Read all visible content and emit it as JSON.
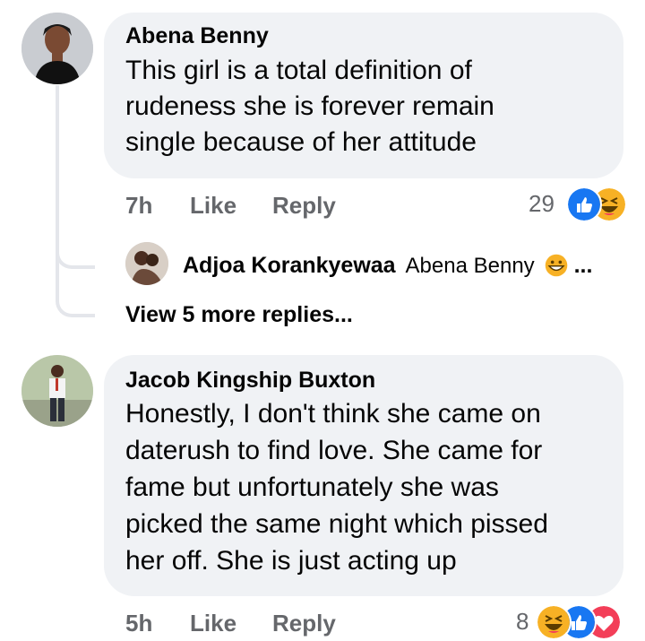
{
  "comments": [
    {
      "author": "Abena Benny",
      "lines": [
        "This girl is a total definition of",
        "rudeness she is forever remain",
        "single because of her attitude"
      ],
      "time": "7h",
      "like_label": "Like",
      "reply_label": "Reply",
      "reaction_count": "29",
      "reactions": [
        "like-icon",
        "haha-icon"
      ]
    },
    {
      "author": "Jacob Kingship Buxton",
      "lines": [
        "Honestly, I don't think she came on",
        "daterush to find love. She came for",
        "fame but unfortunately she was",
        "picked the same night which pissed",
        "her off. She is just acting up"
      ],
      "time": "5h",
      "like_label": "Like",
      "reply_label": "Reply",
      "reaction_count": "8",
      "reactions": [
        "haha-icon",
        "like-icon",
        "love-icon"
      ]
    }
  ],
  "reply_preview": {
    "author": "Adjoa Korankyewaa",
    "text": "Abena Benny",
    "ellipsis": "..."
  },
  "view_more": "View 5 more replies...",
  "colors": {
    "bubble": "#f0f2f5",
    "secondary_text": "#65676b",
    "like_blue": "#1877f2",
    "haha_yellow": "#f7b125",
    "love_red": "#f33e58"
  }
}
